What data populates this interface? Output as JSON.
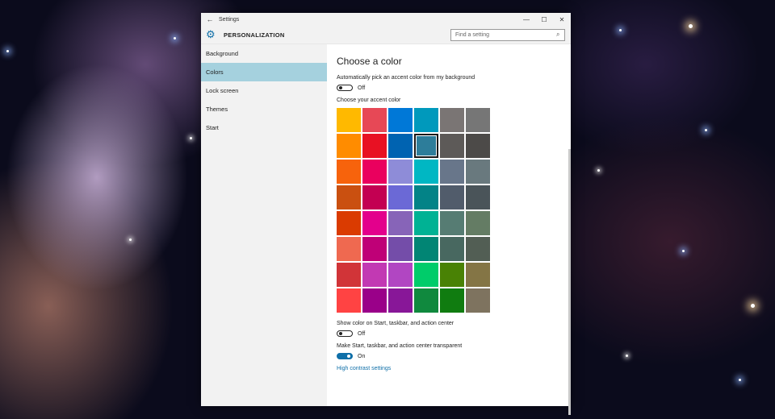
{
  "window": {
    "title": "Settings",
    "back_icon": "←",
    "minimize": "—",
    "maximize": "☐",
    "close": "✕"
  },
  "header": {
    "section": "PERSONALIZATION",
    "search_placeholder": "Find a setting",
    "gear_icon": "⚙",
    "search_icon": "⌕"
  },
  "sidebar": {
    "items": [
      {
        "label": "Background"
      },
      {
        "label": "Colors"
      },
      {
        "label": "Lock screen"
      },
      {
        "label": "Themes"
      },
      {
        "label": "Start"
      }
    ]
  },
  "content": {
    "title": "Choose a color",
    "auto_pick_label": "Automatically pick an accent color from my background",
    "auto_pick_state": "Off",
    "accent_label": "Choose your accent color",
    "show_color_label": "Show color on Start, taskbar, and action center",
    "show_color_state": "Off",
    "transparent_label": "Make Start, taskbar, and action center transparent",
    "transparent_state": "On",
    "high_contrast_link": "High contrast settings"
  },
  "accent_colors": [
    "#FFB900",
    "#E74856",
    "#0078D7",
    "#0099BC",
    "#7A7574",
    "#767676",
    "#FF8C00",
    "#E81123",
    "#0063B1",
    "#2D7D9A",
    "#5D5A58",
    "#4C4A48",
    "#F7630C",
    "#EA005E",
    "#8E8CD8",
    "#00B7C3",
    "#68768A",
    "#69797E",
    "#CA5010",
    "#C30052",
    "#6B69D6",
    "#038387",
    "#515C6B",
    "#4A5459",
    "#DA3B01",
    "#E3008C",
    "#8764B8",
    "#00B294",
    "#567C73",
    "#647C64",
    "#EF6950",
    "#BF0077",
    "#744DA9",
    "#018574",
    "#486860",
    "#525E54",
    "#D13438",
    "#C239B3",
    "#B146C2",
    "#00CC6A",
    "#498205",
    "#847545",
    "#FF4343",
    "#9A0089",
    "#881798",
    "#10893E",
    "#107C10",
    "#7E735F"
  ],
  "selected_color_index": 9,
  "colors": {
    "accent": "#0F6FA8",
    "sidebar_active": "#A5D1DE"
  }
}
